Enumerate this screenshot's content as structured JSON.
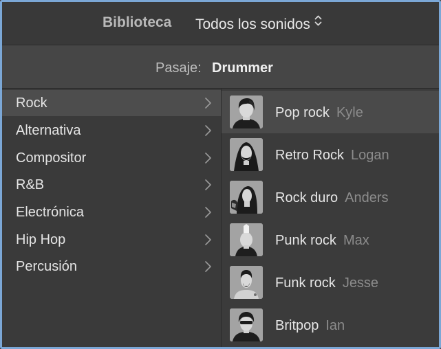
{
  "header": {
    "library_label": "Biblioteca",
    "filter_value": "Todos los sonidos",
    "filter_icon": "up-down-chevron-icon"
  },
  "passage": {
    "label": "Pasaje:",
    "value": "Drummer"
  },
  "genres": [
    {
      "label": "Rock",
      "selected": true
    },
    {
      "label": "Alternativa",
      "selected": false
    },
    {
      "label": "Compositor",
      "selected": false
    },
    {
      "label": "R&B",
      "selected": false
    },
    {
      "label": "Electrónica",
      "selected": false
    },
    {
      "label": "Hip Hop",
      "selected": false
    },
    {
      "label": "Percusión",
      "selected": false
    }
  ],
  "drummers": [
    {
      "style": "Pop rock",
      "name": "Kyle",
      "selected": true
    },
    {
      "style": "Retro Rock",
      "name": "Logan",
      "selected": false
    },
    {
      "style": "Rock duro",
      "name": "Anders",
      "selected": false
    },
    {
      "style": "Punk rock",
      "name": "Max",
      "selected": false
    },
    {
      "style": "Funk rock",
      "name": "Jesse",
      "selected": false
    },
    {
      "style": "Britpop",
      "name": "Ian",
      "selected": false
    }
  ],
  "colors": {
    "background": "#3b3b3b",
    "selected_row": "#4d4d4d",
    "focus_border": "#7ba7d6",
    "secondary_text": "#8c8c8c"
  }
}
